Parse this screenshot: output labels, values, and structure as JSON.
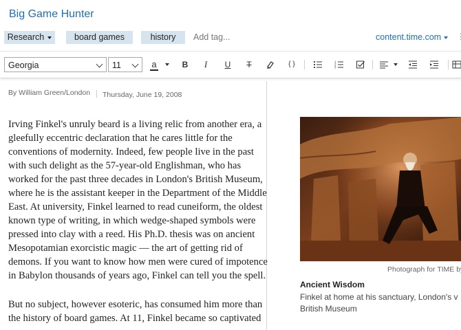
{
  "note": {
    "title": "Big Game Hunter"
  },
  "tags": {
    "notebook": "Research",
    "items": [
      "board games",
      "history"
    ],
    "add_placeholder": "Add tag...",
    "source_url": "content.time.com"
  },
  "toolbar": {
    "font_family": "Georgia",
    "font_size": "11",
    "text_color_glyph": "a",
    "bold_glyph": "B",
    "italic_glyph": "I",
    "underline_glyph": "U",
    "strike_glyph": "T",
    "code_glyph": "{ }",
    "colors": {
      "accent": "#1f6fb5",
      "tag_bg": "#d6e4ef"
    }
  },
  "article": {
    "byline": "By William Green/London",
    "date": "Thursday, June 19, 2008",
    "paragraph1_lines": [
      "Irving Finkel's unruly beard is a living relic from another era, a",
      "gleefully eccentric declaration that he cares little for the",
      "conventions of modernity. Indeed, few people live in the past",
      "with such delight as the 57-year-old Englishman, who has",
      "worked for the past three decades in London's British Museum,",
      "where he is the assistant keeper in the Department of the Middle",
      "East. At university, Finkel learned to read cuneiform, the oldest",
      "known type of writing, in which wedge-shaped symbols were",
      "pressed into clay with a reed. His Ph.D. thesis was on ancient",
      "Mesopotamian exorcistic magic — the art of getting rid of",
      "demons. If you want to know how men were cured of impotence",
      "in Babylon thousands of years ago, Finkel can tell you the spell."
    ],
    "paragraph2_lines": [
      "But no subject, however esoteric, has consumed him more than",
      "the history of board games. At 11, Finkel became so captivated"
    ]
  },
  "figure": {
    "credit": "Photograph for TIME by",
    "caption_title": "Ancient Wisdom",
    "caption_lines": [
      "Finkel at home at his sanctuary, London's v",
      "British Museum"
    ]
  }
}
